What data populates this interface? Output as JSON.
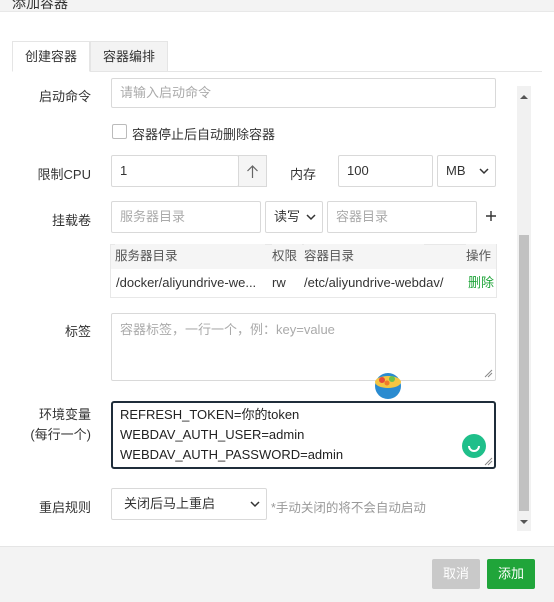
{
  "dialog": {
    "title": "添加容器"
  },
  "tabs": [
    {
      "label": "创建容器",
      "active": true
    },
    {
      "label": "容器编排",
      "active": false
    }
  ],
  "form": {
    "command": {
      "label": "启动命令",
      "placeholder": "请输入启动命令"
    },
    "auto_remove": {
      "label": "容器停止后自动删除容器",
      "checked": false
    },
    "cpu": {
      "label": "限制CPU",
      "value": "1",
      "stepper_icon": "arrow-up-icon"
    },
    "memory": {
      "label": "内存",
      "value": "100",
      "unit": "MB"
    },
    "volume": {
      "label": "挂载卷",
      "server_placeholder": "服务器目录",
      "permission": "读写",
      "container_placeholder": "容器目录",
      "table": {
        "headers": {
          "server_dir": "服务器目录",
          "permission": "权限",
          "container_dir": "容器目录",
          "action": "操作"
        },
        "rows": [
          {
            "server_dir": "/docker/aliyundrive-we...",
            "permission": "rw",
            "container_dir": "/etc/aliyundrive-webdav/",
            "action": "删除"
          }
        ]
      }
    },
    "labels": {
      "label": "标签",
      "placeholder": "容器标签，一行一个，例：key=value"
    },
    "env": {
      "label_line1": "环境变量",
      "label_line2": "(每行一个)",
      "lines": [
        "REFRESH_TOKEN=你的token",
        "WEBDAV_AUTH_USER=admin",
        "WEBDAV_AUTH_PASSWORD=admin"
      ]
    },
    "restart": {
      "label": "重启规则",
      "value": "关闭后马上重启",
      "hint": "*手动关闭的将不会自动启动"
    }
  },
  "footer": {
    "cancel_label": "取消",
    "add_label": "添加"
  },
  "colors": {
    "accent": "#20a53a",
    "cancel_disabled": "#c9c9c9",
    "env_border": "#1f2d3a"
  }
}
